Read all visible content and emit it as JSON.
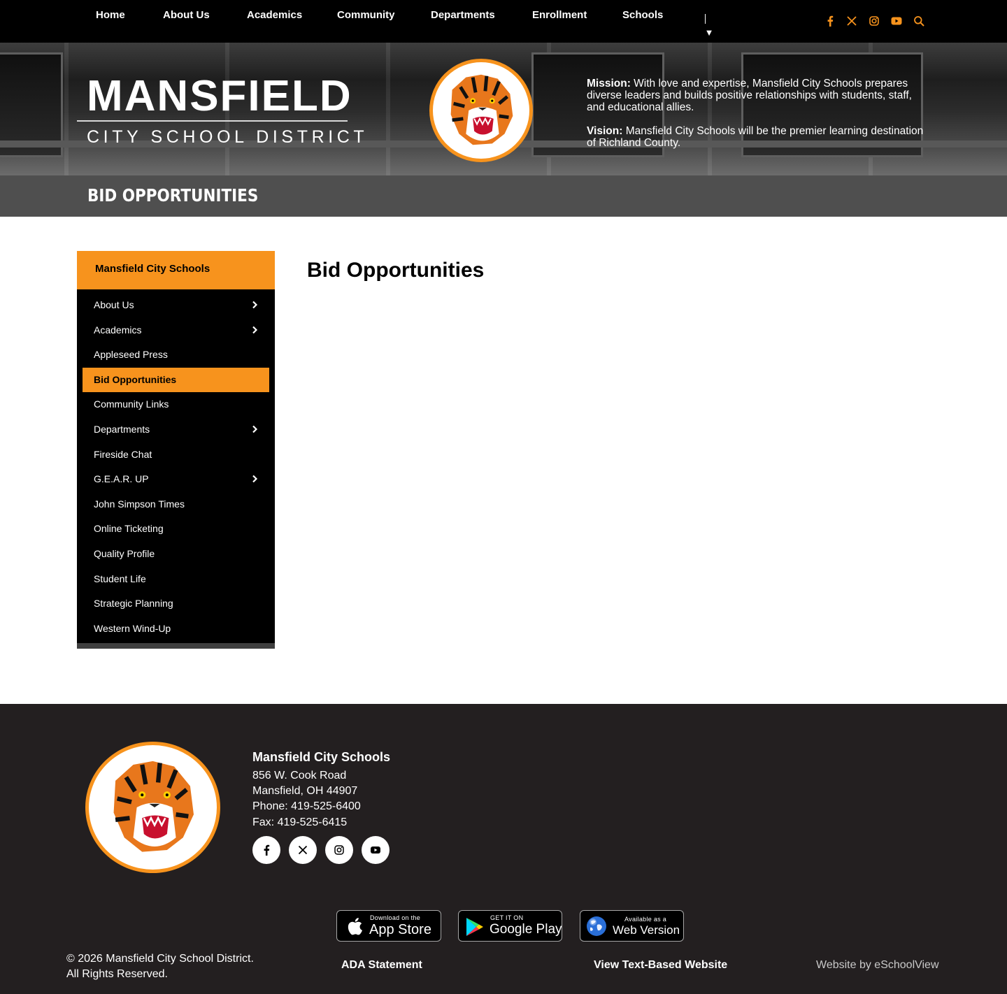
{
  "nav": {
    "items": [
      "Home",
      "About Us",
      "Academics",
      "Community",
      "Departments",
      "Enrollment",
      "Schools"
    ],
    "more_glyph": "▼",
    "social_icons": [
      "facebook-icon",
      "x-icon",
      "instagram-icon",
      "youtube-icon",
      "search-icon"
    ]
  },
  "hero": {
    "title": "MANSFIELD",
    "subtitle": "CITY SCHOOL DISTRICT",
    "mission_label": "Mission:",
    "mission_text": " With love and expertise, Mansfield City Schools prepares diverse leaders and builds positive relationships with students, staff, and educational allies.",
    "vision_label": "Vision:",
    "vision_text": " Mansfield City Schools will be the premier learning destination of Richland County."
  },
  "page_title": "BID OPPORTUNITIES",
  "sidebar": {
    "heading": "Mansfield City Schools",
    "items": [
      {
        "label": "About Us",
        "has_children": true
      },
      {
        "label": "Academics",
        "has_children": true
      },
      {
        "label": "Appleseed Press",
        "has_children": false
      },
      {
        "label": "Bid Opportunities",
        "has_children": false,
        "active": true
      },
      {
        "label": "Community Links",
        "has_children": false
      },
      {
        "label": "Departments",
        "has_children": true
      },
      {
        "label": "Fireside Chat",
        "has_children": false
      },
      {
        "label": "G.E.A.R. UP",
        "has_children": true
      },
      {
        "label": "John Simpson Times",
        "has_children": false
      },
      {
        "label": "Online Ticketing",
        "has_children": false
      },
      {
        "label": "Quality Profile",
        "has_children": false
      },
      {
        "label": "Student Life",
        "has_children": false
      },
      {
        "label": "Strategic Planning",
        "has_children": false
      },
      {
        "label": "Western Wind-Up",
        "has_children": false
      }
    ]
  },
  "main": {
    "heading": "Bid Opportunities"
  },
  "footer": {
    "org_name": "Mansfield City Schools",
    "address_1": "856 W. Cook Road",
    "address_2": "Mansfield, OH 44907",
    "phone": "Phone: 419-525-6400",
    "fax": "Fax: 419-525-6415",
    "social_icons": [
      "facebook-icon",
      "x-icon",
      "instagram-icon",
      "youtube-icon"
    ],
    "badges": {
      "appstore_small": "Download on the",
      "appstore_big": "App Store",
      "googleplay_small": "GET IT ON",
      "googleplay_big": "Google Play",
      "web_small": "Available as a",
      "web_big": "Web Version"
    },
    "copyright_1": "© 2026 Mansfield City School District.",
    "copyright_2": "All Rights Reserved.",
    "ada_link": "ADA Statement",
    "text_site_link": "View Text-Based Website",
    "credit": "Website by eSchoolView"
  },
  "colors": {
    "accent": "#f7931d",
    "nav_bg": "#000000",
    "titlebar_bg": "#4f4f4f",
    "footer_bg": "#231f20"
  }
}
